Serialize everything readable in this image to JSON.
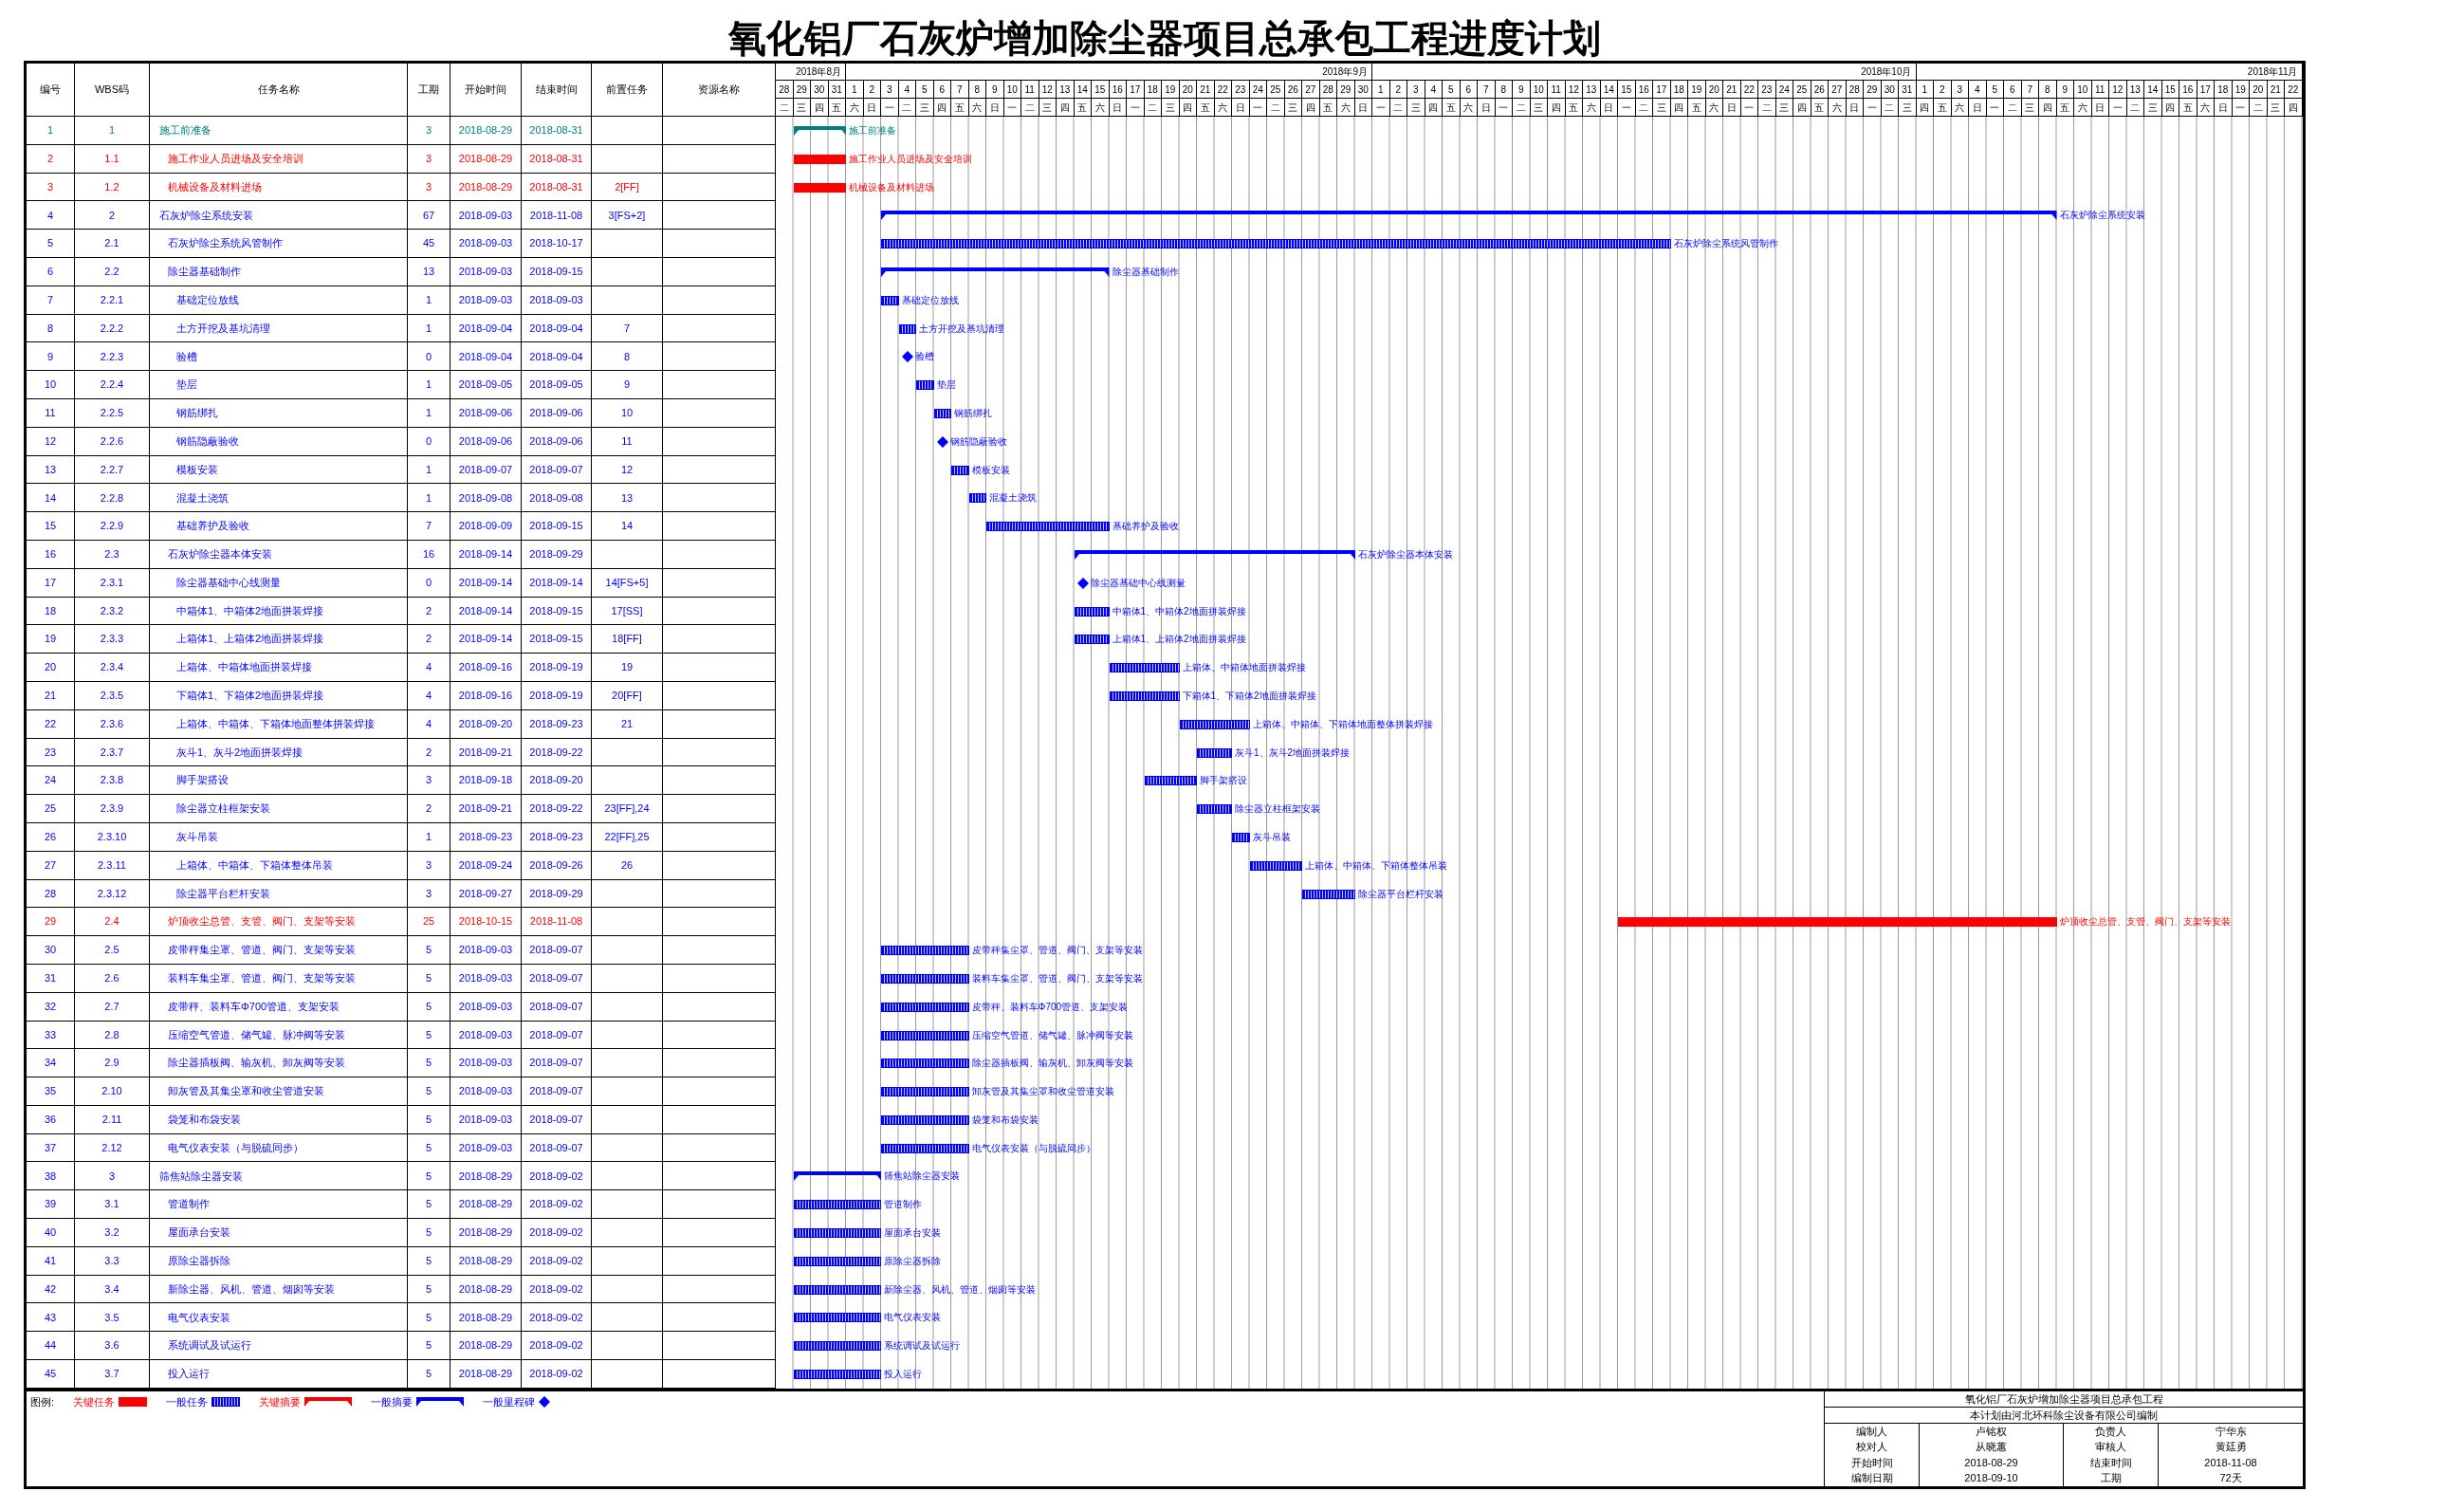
{
  "title": "氧化铝厂石灰炉增加除尘器项目总承包工程进度计划",
  "table": {
    "columns": [
      "编号",
      "WBS码",
      "任务名称",
      "工期",
      "开始时间",
      "结束时间",
      "前置任务",
      "资源名称"
    ]
  },
  "timeline": {
    "months": [
      {
        "label": "2018年8月",
        "days": [
          {
            "day": "28",
            "weekday": "二"
          },
          {
            "day": "29",
            "weekday": "三"
          },
          {
            "day": "30",
            "weekday": "四"
          },
          {
            "day": "31",
            "weekday": "五"
          }
        ]
      },
      {
        "label": "2018年9月",
        "days": [
          {
            "day": "1",
            "weekday": "六"
          },
          {
            "day": "2",
            "weekday": "日"
          },
          {
            "day": "3",
            "weekday": "一"
          },
          {
            "day": "4",
            "weekday": "二"
          },
          {
            "day": "5",
            "weekday": "三"
          },
          {
            "day": "6",
            "weekday": "四"
          },
          {
            "day": "7",
            "weekday": "五"
          },
          {
            "day": "8",
            "weekday": "六"
          },
          {
            "day": "9",
            "weekday": "日"
          },
          {
            "day": "10",
            "weekday": "一"
          },
          {
            "day": "11",
            "weekday": "二"
          },
          {
            "day": "12",
            "weekday": "三"
          },
          {
            "day": "13",
            "weekday": "四"
          },
          {
            "day": "14",
            "weekday": "五"
          },
          {
            "day": "15",
            "weekday": "六"
          },
          {
            "day": "16",
            "weekday": "日"
          },
          {
            "day": "17",
            "weekday": "一"
          },
          {
            "day": "18",
            "weekday": "二"
          },
          {
            "day": "19",
            "weekday": "三"
          },
          {
            "day": "20",
            "weekday": "四"
          },
          {
            "day": "21",
            "weekday": "五"
          },
          {
            "day": "22",
            "weekday": "六"
          },
          {
            "day": "23",
            "weekday": "日"
          },
          {
            "day": "24",
            "weekday": "一"
          },
          {
            "day": "25",
            "weekday": "二"
          },
          {
            "day": "26",
            "weekday": "三"
          },
          {
            "day": "27",
            "weekday": "四"
          },
          {
            "day": "28",
            "weekday": "五"
          },
          {
            "day": "29",
            "weekday": "六"
          },
          {
            "day": "30",
            "weekday": "日"
          }
        ]
      },
      {
        "label": "2018年10月",
        "days": [
          {
            "day": "1",
            "weekday": "一"
          },
          {
            "day": "2",
            "weekday": "二"
          },
          {
            "day": "3",
            "weekday": "三"
          },
          {
            "day": "4",
            "weekday": "四"
          },
          {
            "day": "5",
            "weekday": "五"
          },
          {
            "day": "6",
            "weekday": "六"
          },
          {
            "day": "7",
            "weekday": "日"
          },
          {
            "day": "8",
            "weekday": "一"
          },
          {
            "day": "9",
            "weekday": "二"
          },
          {
            "day": "10",
            "weekday": "三"
          },
          {
            "day": "11",
            "weekday": "四"
          },
          {
            "day": "12",
            "weekday": "五"
          },
          {
            "day": "13",
            "weekday": "六"
          },
          {
            "day": "14",
            "weekday": "日"
          },
          {
            "day": "15",
            "weekday": "一"
          },
          {
            "day": "16",
            "weekday": "二"
          },
          {
            "day": "17",
            "weekday": "三"
          },
          {
            "day": "18",
            "weekday": "四"
          },
          {
            "day": "19",
            "weekday": "五"
          },
          {
            "day": "20",
            "weekday": "六"
          },
          {
            "day": "21",
            "weekday": "日"
          },
          {
            "day": "22",
            "weekday": "一"
          },
          {
            "day": "23",
            "weekday": "二"
          },
          {
            "day": "24",
            "weekday": "三"
          },
          {
            "day": "25",
            "weekday": "四"
          },
          {
            "day": "26",
            "weekday": "五"
          },
          {
            "day": "27",
            "weekday": "六"
          },
          {
            "day": "28",
            "weekday": "日"
          },
          {
            "day": "29",
            "weekday": "一"
          },
          {
            "day": "30",
            "weekday": "二"
          },
          {
            "day": "31",
            "weekday": "三"
          }
        ]
      },
      {
        "label": "2018年11月",
        "days": [
          {
            "day": "1",
            "weekday": "四"
          },
          {
            "day": "2",
            "weekday": "五"
          },
          {
            "day": "3",
            "weekday": "六"
          },
          {
            "day": "4",
            "weekday": "日"
          },
          {
            "day": "5",
            "weekday": "一"
          },
          {
            "day": "6",
            "weekday": "二"
          },
          {
            "day": "7",
            "weekday": "三"
          },
          {
            "day": "8",
            "weekday": "四"
          },
          {
            "day": "9",
            "weekday": "五"
          },
          {
            "day": "10",
            "weekday": "六"
          },
          {
            "day": "11",
            "weekday": "日"
          },
          {
            "day": "12",
            "weekday": "一"
          },
          {
            "day": "13",
            "weekday": "二"
          },
          {
            "day": "14",
            "weekday": "三"
          },
          {
            "day": "15",
            "weekday": "四"
          },
          {
            "day": "16",
            "weekday": "五"
          },
          {
            "day": "17",
            "weekday": "六"
          },
          {
            "day": "18",
            "weekday": "日"
          },
          {
            "day": "19",
            "weekday": "一"
          },
          {
            "day": "20",
            "weekday": "二"
          },
          {
            "day": "21",
            "weekday": "三"
          },
          {
            "day": "22",
            "weekday": "四"
          }
        ]
      }
    ]
  },
  "tasks": [
    {
      "no": "1",
      "wbs": "1",
      "name": "施工前准备",
      "duration": "3",
      "start": "2018-08-29",
      "end": "2018-08-31",
      "kind": "summary",
      "color": "#008080",
      "bar_label": "施工前准备",
      "children": [
        {
          "no": "2",
          "wbs": "1.1",
          "name": "施工作业人员进场及安全培训",
          "duration": "3",
          "start": "2018-08-29",
          "end": "2018-08-31",
          "kind": "critical",
          "color": "#ff0000",
          "bar_label": "施工作业人员进场及安全培训"
        },
        {
          "no": "3",
          "wbs": "1.2",
          "name": "机械设备及材料进场",
          "duration": "3",
          "start": "2018-08-29",
          "end": "2018-08-31",
          "predecessors": "2[FF]",
          "kind": "critical",
          "color": "#ff0000",
          "bar_label": "机械设备及材料进场"
        }
      ]
    },
    {
      "no": "4",
      "wbs": "2",
      "name": "石灰炉除尘系统安装",
      "duration": "67",
      "start": "2018-09-03",
      "end": "2018-11-08",
      "predecessors": "3[FS+2]",
      "kind": "summary",
      "color": "#0000ff",
      "bar_label": "石灰炉除尘系统安装",
      "children": [
        {
          "no": "5",
          "wbs": "2.1",
          "name": "石灰炉除尘系统风管制作",
          "duration": "45",
          "start": "2018-09-03",
          "end": "2018-10-17",
          "kind": "task",
          "color": "#0000ff",
          "bar_label": "石灰炉除尘系统风管制作"
        },
        {
          "no": "6",
          "wbs": "2.2",
          "name": "除尘器基础制作",
          "duration": "13",
          "start": "2018-09-03",
          "end": "2018-09-15",
          "kind": "summary",
          "color": "#0000ff",
          "bar_label": "除尘器基础制作",
          "children": [
            {
              "no": "7",
              "wbs": "2.2.1",
              "name": "基础定位放线",
              "duration": "1",
              "start": "2018-09-03",
              "end": "2018-09-03",
              "kind": "task",
              "color": "#0000ff",
              "bar_label": "基础定位放线"
            },
            {
              "no": "8",
              "wbs": "2.2.2",
              "name": "土方开挖及基坑清理",
              "duration": "1",
              "start": "2018-09-04",
              "end": "2018-09-04",
              "predecessors": "7",
              "kind": "task",
              "color": "#0000ff",
              "bar_label": "土方开挖及基坑清理"
            },
            {
              "no": "9",
              "wbs": "2.2.3",
              "name": "验槽",
              "duration": "0",
              "start": "2018-09-04",
              "end": "2018-09-04",
              "predecessors": "8",
              "kind": "milestone",
              "color": "#0000ff",
              "bar_label": "验槽"
            },
            {
              "no": "10",
              "wbs": "2.2.4",
              "name": "垫层",
              "duration": "1",
              "start": "2018-09-05",
              "end": "2018-09-05",
              "predecessors": "9",
              "kind": "task",
              "color": "#0000ff",
              "bar_label": "垫层"
            },
            {
              "no": "11",
              "wbs": "2.2.5",
              "name": "钢筋绑扎",
              "duration": "1",
              "start": "2018-09-06",
              "end": "2018-09-06",
              "predecessors": "10",
              "kind": "task",
              "color": "#0000ff",
              "bar_label": "钢筋绑扎"
            },
            {
              "no": "12",
              "wbs": "2.2.6",
              "name": "钢筋隐蔽验收",
              "duration": "0",
              "start": "2018-09-06",
              "end": "2018-09-06",
              "predecessors": "11",
              "kind": "milestone",
              "color": "#0000ff",
              "bar_label": "钢筋隐蔽验收"
            },
            {
              "no": "13",
              "wbs": "2.2.7",
              "name": "模板安装",
              "duration": "1",
              "start": "2018-09-07",
              "end": "2018-09-07",
              "predecessors": "12",
              "kind": "task",
              "color": "#0000ff",
              "bar_label": "模板安装"
            },
            {
              "no": "14",
              "wbs": "2.2.8",
              "name": "混凝土浇筑",
              "duration": "1",
              "start": "2018-09-08",
              "end": "2018-09-08",
              "predecessors": "13",
              "kind": "task",
              "color": "#0000ff",
              "bar_label": "混凝土浇筑"
            },
            {
              "no": "15",
              "wbs": "2.2.9",
              "name": "基础养护及验收",
              "duration": "7",
              "start": "2018-09-09",
              "end": "2018-09-15",
              "predecessors": "14",
              "kind": "task",
              "color": "#0000ff",
              "bar_label": "基础养护及验收"
            }
          ]
        },
        {
          "no": "16",
          "wbs": "2.3",
          "name": "石灰炉除尘器本体安装",
          "duration": "16",
          "start": "2018-09-14",
          "end": "2018-09-29",
          "kind": "summary",
          "color": "#0000ff",
          "bar_label": "石灰炉除尘器本体安装",
          "children": [
            {
              "no": "17",
              "wbs": "2.3.1",
              "name": "除尘器基础中心线测量",
              "duration": "0",
              "start": "2018-09-14",
              "end": "2018-09-14",
              "predecessors": "14[FS+5]",
              "kind": "milestone",
              "color": "#0000ff",
              "bar_label": "除尘器基础中心线测量"
            },
            {
              "no": "18",
              "wbs": "2.3.2",
              "name": "中箱体1、中箱体2地面拼装焊接",
              "duration": "2",
              "start": "2018-09-14",
              "end": "2018-09-15",
              "predecessors": "17[SS]",
              "kind": "task",
              "color": "#0000ff",
              "bar_label": "中箱体1、中箱体2地面拼装焊接"
            },
            {
              "no": "19",
              "wbs": "2.3.3",
              "name": "上箱体1、上箱体2地面拼装焊接",
              "duration": "2",
              "start": "2018-09-14",
              "end": "2018-09-15",
              "predecessors": "18[FF]",
              "kind": "task",
              "color": "#0000ff",
              "bar_label": "上箱体1、上箱体2地面拼装焊接"
            },
            {
              "no": "20",
              "wbs": "2.3.4",
              "name": "上箱体、中箱体地面拼装焊接",
              "duration": "4",
              "start": "2018-09-16",
              "end": "2018-09-19",
              "predecessors": "19",
              "kind": "task",
              "color": "#0000ff",
              "bar_label": "上箱体、中箱体地面拼装焊接"
            },
            {
              "no": "21",
              "wbs": "2.3.5",
              "name": "下箱体1、下箱体2地面拼装焊接",
              "duration": "4",
              "start": "2018-09-16",
              "end": "2018-09-19",
              "predecessors": "20[FF]",
              "kind": "task",
              "color": "#0000ff",
              "bar_label": "下箱体1、下箱体2地面拼装焊接"
            },
            {
              "no": "22",
              "wbs": "2.3.6",
              "name": "上箱体、中箱体、下箱体地面整体拼装焊接",
              "duration": "4",
              "start": "2018-09-20",
              "end": "2018-09-23",
              "predecessors": "21",
              "kind": "task",
              "color": "#0000ff",
              "bar_label": "上箱体、中箱体、下箱体地面整体拼装焊接"
            },
            {
              "no": "23",
              "wbs": "2.3.7",
              "name": "灰斗1、灰斗2地面拼装焊接",
              "duration": "2",
              "start": "2018-09-21",
              "end": "2018-09-22",
              "kind": "task",
              "color": "#0000ff",
              "bar_label": "灰斗1、灰斗2地面拼装焊接"
            },
            {
              "no": "24",
              "wbs": "2.3.8",
              "name": "脚手架搭设",
              "duration": "3",
              "start": "2018-09-18",
              "end": "2018-09-20",
              "kind": "task",
              "color": "#0000ff",
              "bar_label": "脚手架搭设"
            },
            {
              "no": "25",
              "wbs": "2.3.9",
              "name": "除尘器立柱框架安装",
              "duration": "2",
              "start": "2018-09-21",
              "end": "2018-09-22",
              "predecessors": "23[FF],24",
              "kind": "task",
              "color": "#0000ff",
              "bar_label": "除尘器立柱框架安装"
            },
            {
              "no": "26",
              "wbs": "2.3.10",
              "name": "灰斗吊装",
              "duration": "1",
              "start": "2018-09-23",
              "end": "2018-09-23",
              "predecessors": "22[FF],25",
              "kind": "task",
              "color": "#0000ff",
              "bar_label": "灰斗吊装"
            },
            {
              "no": "27",
              "wbs": "2.3.11",
              "name": "上箱体、中箱体、下箱体整体吊装",
              "duration": "3",
              "start": "2018-09-24",
              "end": "2018-09-26",
              "predecessors": "26",
              "kind": "task",
              "color": "#0000ff",
              "bar_label": "上箱体、中箱体、下箱体整体吊装"
            },
            {
              "no": "28",
              "wbs": "2.3.12",
              "name": "除尘器平台栏杆安装",
              "duration": "3",
              "start": "2018-09-27",
              "end": "2018-09-29",
              "kind": "task",
              "color": "#0000ff",
              "bar_label": "除尘器平台栏杆安装"
            }
          ]
        },
        {
          "no": "29",
          "wbs": "2.4",
          "name": "炉顶收尘总管、支管、阀门、支架等安装",
          "duration": "25",
          "start": "2018-10-15",
          "end": "2018-11-08",
          "kind": "critical",
          "color": "#ff0000",
          "bar_label": "炉顶收尘总管、支管、阀门、支架等安装"
        },
        {
          "no": "30",
          "wbs": "2.5",
          "name": "皮带秤集尘罩、管道、阀门、支架等安装",
          "duration": "5",
          "start": "2018-09-03",
          "end": "2018-09-07",
          "kind": "task",
          "color": "#0000ff",
          "bar_label": "皮带秤集尘罩、管道、阀门、支架等安装"
        },
        {
          "no": "31",
          "wbs": "2.6",
          "name": "装料车集尘罩、管道、阀门、支架等安装",
          "duration": "5",
          "start": "2018-09-03",
          "end": "2018-09-07",
          "kind": "task",
          "color": "#0000ff",
          "bar_label": "装料车集尘罩、管道、阀门、支架等安装"
        },
        {
          "no": "32",
          "wbs": "2.7",
          "name": "皮带秤、装料车Φ700管道、支架安装",
          "duration": "5",
          "start": "2018-09-03",
          "end": "2018-09-07",
          "kind": "task",
          "color": "#0000ff",
          "bar_label": "皮带秤、装料车Φ700管道、支架安装"
        },
        {
          "no": "33",
          "wbs": "2.8",
          "name": "压缩空气管道、储气罐、脉冲阀等安装",
          "duration": "5",
          "start": "2018-09-03",
          "end": "2018-09-07",
          "kind": "task",
          "color": "#0000ff",
          "bar_label": "压缩空气管道、储气罐、脉冲阀等安装"
        },
        {
          "no": "34",
          "wbs": "2.9",
          "name": "除尘器插板阀、输灰机、卸灰阀等安装",
          "duration": "5",
          "start": "2018-09-03",
          "end": "2018-09-07",
          "kind": "task",
          "color": "#0000ff",
          "bar_label": "除尘器插板阀、输灰机、卸灰阀等安装"
        },
        {
          "no": "35",
          "wbs": "2.10",
          "name": "卸灰管及其集尘罩和收尘管道安装",
          "duration": "5",
          "start": "2018-09-03",
          "end": "2018-09-07",
          "kind": "task",
          "color": "#0000ff",
          "bar_label": "卸灰管及其集尘罩和收尘管道安装"
        },
        {
          "no": "36",
          "wbs": "2.11",
          "name": "袋笼和布袋安装",
          "duration": "5",
          "start": "2018-09-03",
          "end": "2018-09-07",
          "kind": "task",
          "color": "#0000ff",
          "bar_label": "袋笼和布袋安装"
        },
        {
          "no": "37",
          "wbs": "2.12",
          "name": "电气仪表安装（与脱硫同步）",
          "duration": "5",
          "start": "2018-09-03",
          "end": "2018-09-07",
          "kind": "task",
          "color": "#0000ff",
          "bar_label": "电气仪表安装（与脱硫同步）"
        }
      ]
    },
    {
      "no": "38",
      "wbs": "3",
      "name": "筛焦站除尘器安装",
      "duration": "5",
      "start": "2018-08-29",
      "end": "2018-09-02",
      "kind": "summary",
      "color": "#0000ff",
      "bar_label": "筛焦站除尘器安装",
      "children": [
        {
          "no": "39",
          "wbs": "3.1",
          "name": "管道制作",
          "duration": "5",
          "start": "2018-08-29",
          "end": "2018-09-02",
          "kind": "task",
          "color": "#0000ff",
          "bar_label": "管道制作"
        },
        {
          "no": "40",
          "wbs": "3.2",
          "name": "屋面承台安装",
          "duration": "5",
          "start": "2018-08-29",
          "end": "2018-09-02",
          "kind": "task",
          "color": "#0000ff",
          "bar_label": "屋面承台安装"
        },
        {
          "no": "41",
          "wbs": "3.3",
          "name": "原除尘器拆除",
          "duration": "5",
          "start": "2018-08-29",
          "end": "2018-09-02",
          "kind": "task",
          "color": "#0000ff",
          "bar_label": "原除尘器拆除"
        },
        {
          "no": "42",
          "wbs": "3.4",
          "name": "新除尘器、风机、管道、烟囱等安装",
          "duration": "5",
          "start": "2018-08-29",
          "end": "2018-09-02",
          "kind": "task",
          "color": "#0000ff",
          "bar_label": "新除尘器、风机、管道、烟囱等安装"
        },
        {
          "no": "43",
          "wbs": "3.5",
          "name": "电气仪表安装",
          "duration": "5",
          "start": "2018-08-29",
          "end": "2018-09-02",
          "kind": "task",
          "color": "#0000ff",
          "bar_label": "电气仪表安装"
        },
        {
          "no": "44",
          "wbs": "3.6",
          "name": "系统调试及试运行",
          "duration": "5",
          "start": "2018-08-29",
          "end": "2018-09-02",
          "kind": "task",
          "color": "#0000ff",
          "bar_label": "系统调试及试运行"
        },
        {
          "no": "45",
          "wbs": "3.7",
          "name": "投入运行",
          "duration": "5",
          "start": "2018-08-29",
          "end": "2018-09-02",
          "kind": "task",
          "color": "#0000ff",
          "bar_label": "投入运行"
        }
      ]
    }
  ],
  "legend": {
    "title": "图例:",
    "items": [
      {
        "label": "关键任务",
        "kind": "critical",
        "color": "#ff0000"
      },
      {
        "label": "一般任务",
        "kind": "task",
        "color": "#0000ff"
      },
      {
        "label": "关键摘要",
        "kind": "summary",
        "color": "#ff0000"
      },
      {
        "label": "一般摘要",
        "kind": "summary",
        "color": "#0000ff"
      },
      {
        "label": "一般里程碑",
        "kind": "milestone",
        "color": "#0000ff"
      }
    ]
  },
  "info_block": {
    "title": "氧化铝厂石灰炉增加除尘器项目总承包工程",
    "subtitle": "本计划由河北环科除尘设备有限公司编制",
    "rows": [
      [
        "编制人",
        "卢铭权",
        "负责人",
        "宁华东"
      ],
      [
        "校对人",
        "从晓蕙",
        "审核人",
        "黄廷勇"
      ],
      [
        "开始时间",
        "2018-08-29",
        "结束时间",
        "2018-11-08"
      ],
      [
        "编制日期",
        "2018-09-10",
        "工期",
        "72天"
      ]
    ]
  }
}
